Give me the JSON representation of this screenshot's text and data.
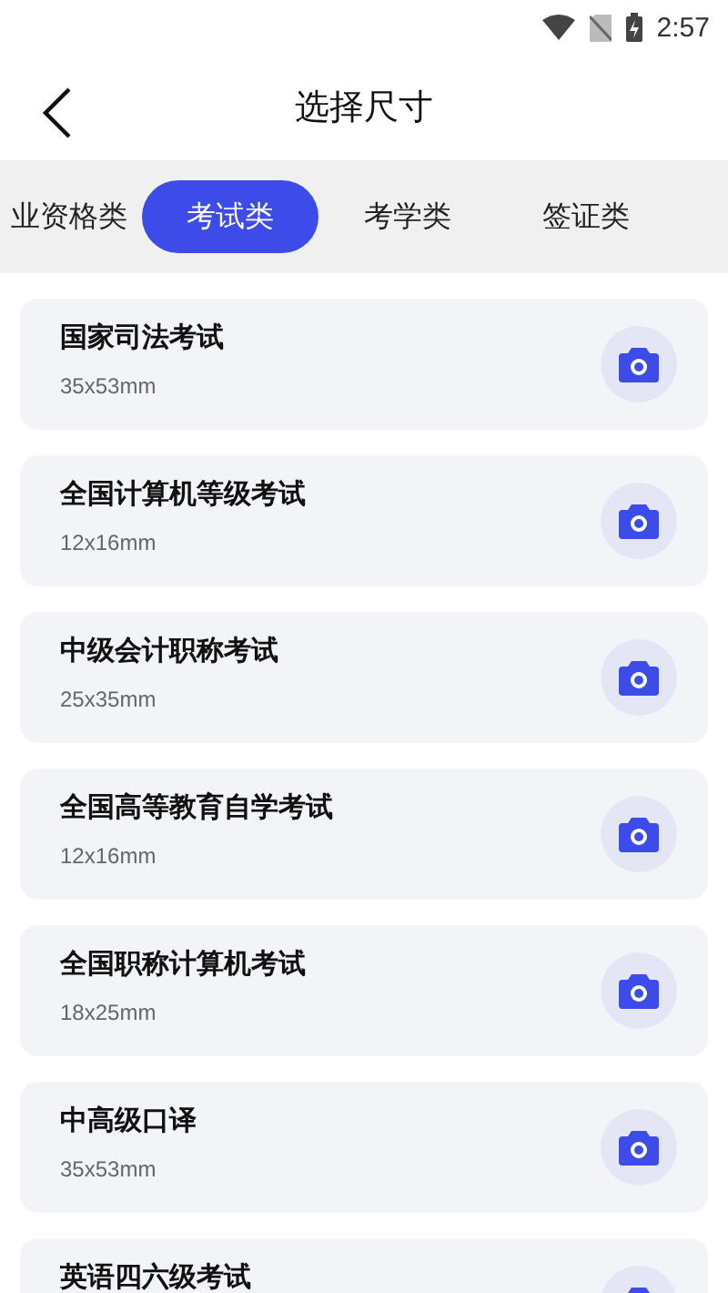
{
  "status_bar": {
    "time": "2:57"
  },
  "header": {
    "title": "选择尺寸"
  },
  "tabs": [
    {
      "label": "业资格类",
      "selected": false
    },
    {
      "label": "考试类",
      "selected": true
    },
    {
      "label": "考学类",
      "selected": false
    },
    {
      "label": "签证类",
      "selected": false
    }
  ],
  "items": [
    {
      "name": "国家司法考试",
      "size": "35x53mm"
    },
    {
      "name": "全国计算机等级考试",
      "size": "12x16mm"
    },
    {
      "name": "中级会计职称考试",
      "size": "25x35mm"
    },
    {
      "name": "全国高等教育自学考试",
      "size": "12x16mm"
    },
    {
      "name": "全国职称计算机考试",
      "size": "18x25mm"
    },
    {
      "name": "中高级口译",
      "size": "35x53mm"
    },
    {
      "name": "英语四六级考试"
    }
  ]
}
